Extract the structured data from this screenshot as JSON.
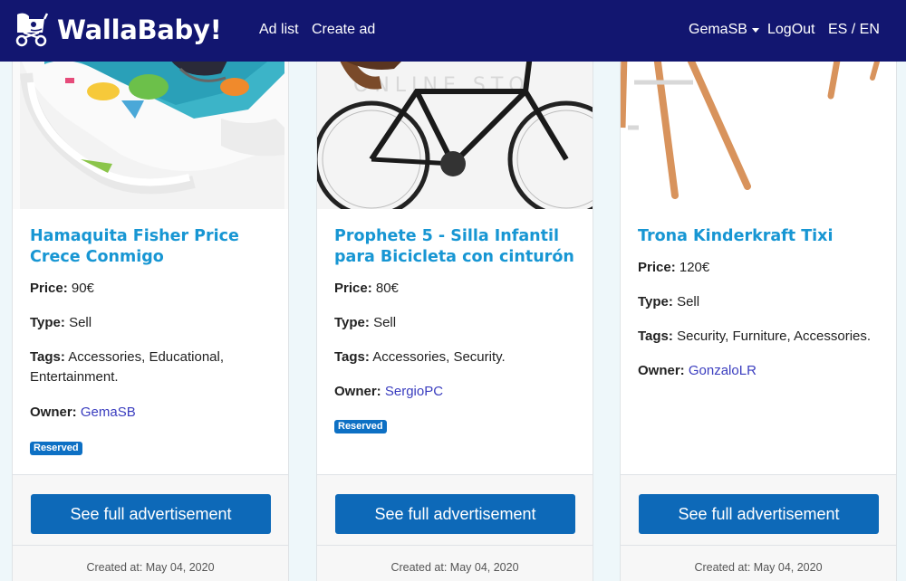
{
  "nav": {
    "brand": "WallaBaby!",
    "ad_list": "Ad list",
    "create_ad": "Create ad",
    "user": "GemaSB",
    "logout": "LogOut",
    "language": "ES / EN",
    "colors": {
      "bar": "#121670",
      "text": "#ffffff"
    }
  },
  "labels": {
    "price": "Price:",
    "type": "Type:",
    "tags": "Tags:",
    "owner": "Owner:"
  },
  "ads": [
    {
      "title": "Hamaquita Fisher Price Crece Conmigo",
      "price": "90€",
      "type": "Sell",
      "tags": "Accessories, Educational, Entertainment.",
      "owner": "GemaSB",
      "badge": "Reserved",
      "button": "See full advertisement",
      "created": "Created at: May 04, 2020",
      "image_icon": "baby-rocker-image"
    },
    {
      "title": "Prophete 5 - Silla Infantil para Bicicleta con cinturón",
      "price": "80€",
      "type": "Sell",
      "tags": "Accessories, Security.",
      "owner": "SergioPC",
      "badge": "Reserved",
      "button": "See full advertisement",
      "created": "Created at: May 04, 2020",
      "image_icon": "bicycle-image",
      "image_watermark": "ONLINE STO"
    },
    {
      "title": "Trona Kinderkraft Tixi",
      "price": "120€",
      "type": "Sell",
      "tags": "Security, Furniture, Accessories.",
      "owner": "GonzaloLR",
      "button": "See full advertisement",
      "created": "Created at: May 04, 2020",
      "image_icon": "high-chair-image"
    }
  ],
  "colors": {
    "title": "#1796d3",
    "owner_link": "#3a3dbf",
    "button": "#0d69b8",
    "badge": "#0d70c4",
    "background": "#eef7fa"
  }
}
